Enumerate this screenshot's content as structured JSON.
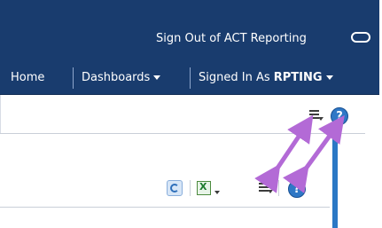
{
  "header": {
    "signout_label": "Sign Out of ACT Reporting",
    "nav": {
      "home": "Home",
      "dashboards": "Dashboards",
      "signed_in_prefix": "Signed In As",
      "username": "RPTING"
    }
  },
  "page_toolbar": {
    "help_label": "?"
  },
  "panel_toolbar": {
    "help_label": "?"
  },
  "icons": {
    "toggle": "toggle-icon",
    "refresh": "refresh-icon",
    "excel": "excel-export-icon",
    "page_options": "page-options-menu-icon",
    "panel_options": "panel-options-menu-icon",
    "help": "help-icon"
  },
  "colors": {
    "header_bg": "#193c6e",
    "accent_blue": "#2b78c5",
    "annotation_arrow": "#b36ad6"
  }
}
